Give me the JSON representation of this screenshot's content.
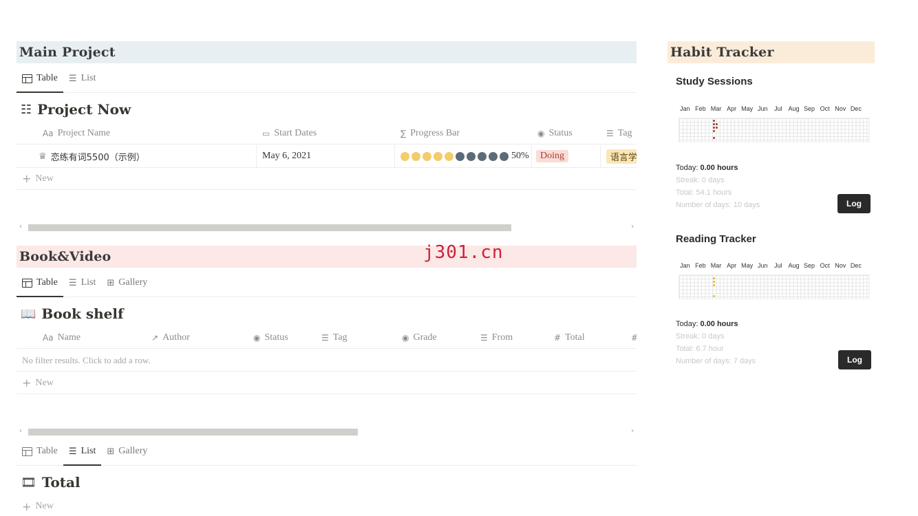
{
  "main_project": {
    "banner": "Main Project",
    "tabs": [
      {
        "label": "Table",
        "active": true
      },
      {
        "label": "List",
        "active": false
      }
    ],
    "db_title": "Project Now",
    "columns": [
      {
        "icon": "Aa",
        "label": "Project Name"
      },
      {
        "icon": "▭",
        "label": "Start Dates"
      },
      {
        "icon": "∑",
        "label": "Progress Bar"
      },
      {
        "icon": "◉",
        "label": "Status"
      },
      {
        "icon": "☰",
        "label": "Tag"
      }
    ],
    "row": {
      "name": "恋练有词5500（示例）",
      "start": "May 6, 2021",
      "progress_filled": 5,
      "progress_total": 10,
      "progress_text": "50%",
      "status": "Doing",
      "tag": "语言学"
    },
    "new_label": "New"
  },
  "book_video": {
    "banner": "Book&Video",
    "tabs": [
      {
        "label": "Table",
        "active": true
      },
      {
        "label": "List",
        "active": false
      },
      {
        "label": "Gallery",
        "active": false
      }
    ],
    "db_title": "Book shelf",
    "columns": [
      {
        "icon": "Aa",
        "label": "Name"
      },
      {
        "icon": "↗",
        "label": "Author"
      },
      {
        "icon": "◉",
        "label": "Status"
      },
      {
        "icon": "☰",
        "label": "Tag"
      },
      {
        "icon": "◉",
        "label": "Grade"
      },
      {
        "icon": "☰",
        "label": "From"
      },
      {
        "icon": "#",
        "label": "Total"
      }
    ],
    "empty_text": "No filter results. Click to add a row.",
    "new_label": "New",
    "tabs2": [
      {
        "label": "Table",
        "active": false
      },
      {
        "label": "List",
        "active": true
      },
      {
        "label": "Gallery",
        "active": false
      }
    ],
    "db_title2": "Total",
    "new_label2": "New"
  },
  "watermark": "j301.cn",
  "habit": {
    "banner": "Habit Tracker",
    "months": [
      "Jan",
      "Feb",
      "Mar",
      "Apr",
      "May",
      "Jun",
      "Jul",
      "Aug",
      "Sep",
      "Oct",
      "Nov",
      "Dec"
    ],
    "study": {
      "title": "Study Sessions",
      "today_label": "Today:",
      "today_value": "0.00 hours",
      "streak": "Streak: 0 days",
      "total": "Total: 54.1 hours",
      "days": "Number of days: 10 days",
      "log": "Log",
      "color": "#a33a2a"
    },
    "reading": {
      "title": "Reading Tracker",
      "today_label": "Today:",
      "today_value": "0.00 hours",
      "streak": "Streak: 0 days",
      "total": "Total: 6.7 hour",
      "days": "Number of days: 7 days",
      "log": "Log",
      "color": "#e8b923"
    }
  },
  "colors": {
    "main_banner_bg": "#e7eff3",
    "book_banner_bg": "#fbe8e7",
    "habit_banner_bg": "#fbecd9",
    "dot_filled": "#f2cd6c",
    "dot_empty": "#5b6b78",
    "status_bg": "#fbdcd7",
    "status_fg": "#a5412f",
    "tag_bg": "#fbe6b8"
  }
}
